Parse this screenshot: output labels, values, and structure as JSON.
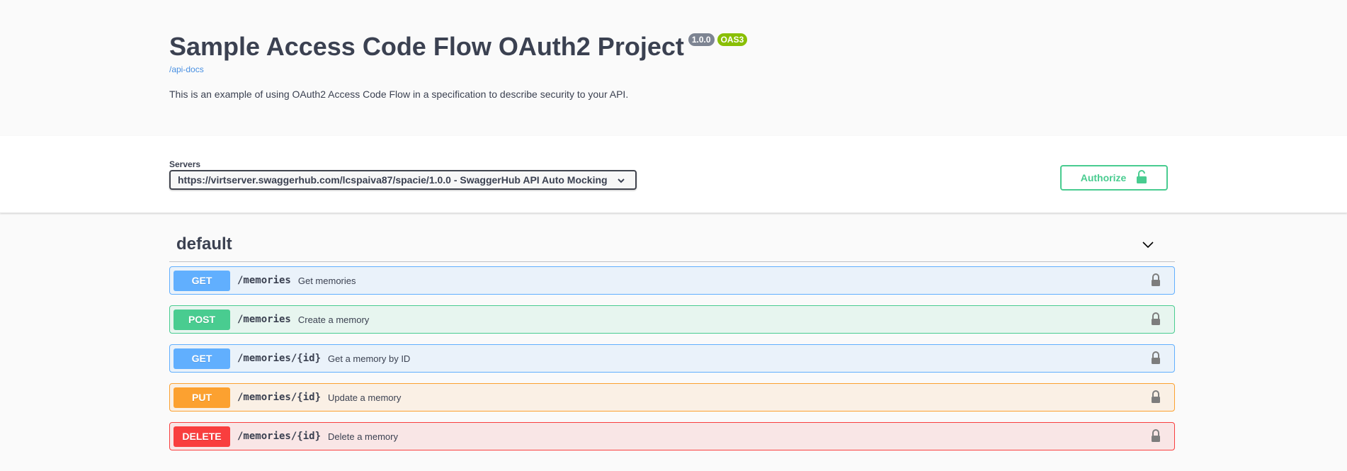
{
  "info": {
    "title": "Sample Access Code Flow OAuth2 Project",
    "version": "1.0.0",
    "oas": "OAS3",
    "api_docs_link": "/api-docs",
    "description": "This is an example of using OAuth2 Access Code Flow in a specification to describe security to your API."
  },
  "servers": {
    "label": "Servers",
    "selected": "https://virtserver.swaggerhub.com/lcspaiva87/spacie/1.0.0 - SwaggerHub API Auto Mocking",
    "authorize_label": "Authorize"
  },
  "section": {
    "tag": "default",
    "operations": [
      {
        "method": "GET",
        "path": "/memories",
        "summary": "Get memories"
      },
      {
        "method": "POST",
        "path": "/memories",
        "summary": "Create a memory"
      },
      {
        "method": "GET",
        "path": "/memories/{id}",
        "summary": "Get a memory by ID"
      },
      {
        "method": "PUT",
        "path": "/memories/{id}",
        "summary": "Update a memory"
      },
      {
        "method": "DELETE",
        "path": "/memories/{id}",
        "summary": "Delete a memory"
      }
    ]
  },
  "colors": {
    "get": "#61affe",
    "post": "#49cc90",
    "put": "#fca130",
    "delete": "#f93e3e",
    "text": "#3b4151",
    "link": "#4990e2"
  },
  "icons": {
    "select_arrow": "chevron-down-icon",
    "authorize": "unlocked-icon",
    "section_toggle": "chevron-down-icon",
    "operation_lock": "lock-icon"
  }
}
